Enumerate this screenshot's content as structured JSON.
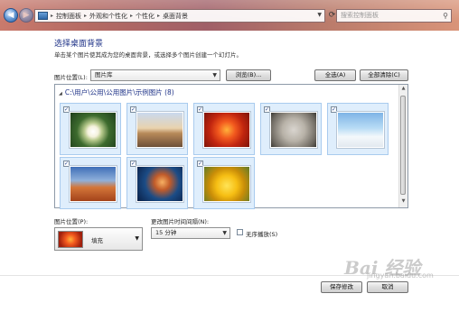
{
  "address_bar": {
    "crumbs": [
      "控制面板",
      "外观和个性化",
      "个性化",
      "桌面背景"
    ],
    "search_placeholder": "搜索控制面板"
  },
  "heading": {
    "title": "选择桌面背景",
    "subtitle": "单击某个图片使其成为您的桌面背景，或选择多个图片创建一个幻灯片。"
  },
  "picture_location": {
    "label": "图片位置(L):",
    "value": "图片库",
    "browse_label": "浏览(B)..."
  },
  "toolbar": {
    "select_all_label": "全选(A)",
    "clear_all_label": "全部清除(C)"
  },
  "gallery": {
    "group_label": "C:\\用户\\公用\\公用图片\\示例图片 (8)",
    "items": [
      {
        "name": "flower",
        "checked": true
      },
      {
        "name": "castle",
        "checked": true
      },
      {
        "name": "chrysanthemum",
        "checked": true
      },
      {
        "name": "koala",
        "checked": true
      },
      {
        "name": "penguins",
        "checked": true
      },
      {
        "name": "desert",
        "checked": true
      },
      {
        "name": "jellyfish",
        "checked": true
      },
      {
        "name": "tulips",
        "checked": true
      }
    ],
    "check_glyph": "✓"
  },
  "picture_position": {
    "label": "图片位置(P):",
    "value": "填充"
  },
  "interval": {
    "label": "更改图片时间间隔(N):",
    "value": "15 分钟"
  },
  "shuffle": {
    "label": "无序播放(S)",
    "checked": false
  },
  "footer": {
    "save_label": "保存修改",
    "cancel_label": "取消"
  },
  "watermark": {
    "text": "Bai 经验",
    "sub": "jingyan.baidu.com"
  }
}
